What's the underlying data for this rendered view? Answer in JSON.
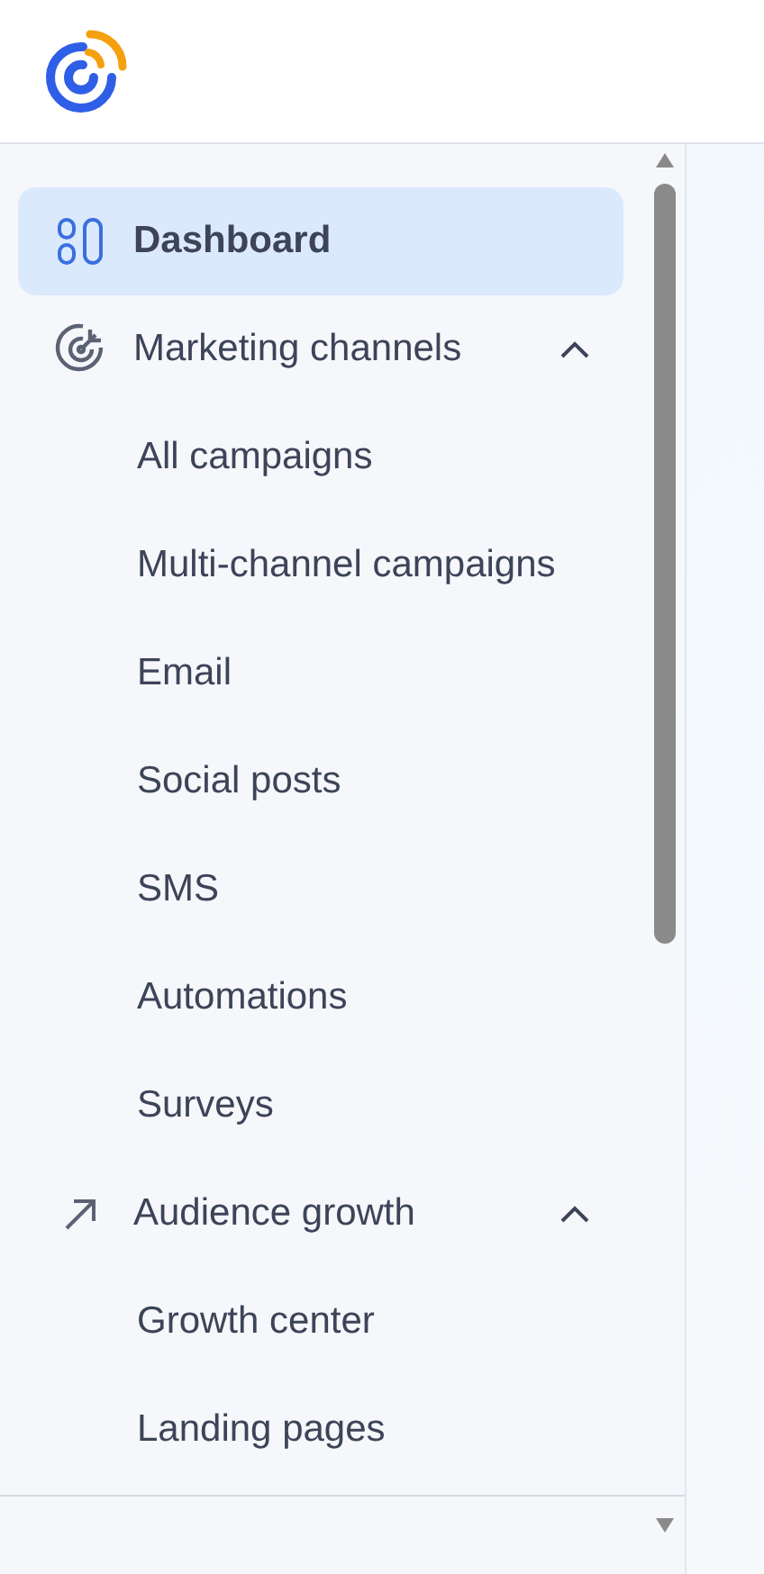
{
  "nav": [
    {
      "label": "Dashboard",
      "selected": true
    },
    {
      "label": "Marketing channels",
      "selected": false,
      "expanded": true,
      "children": [
        {
          "label": "All campaigns",
          "selected": false
        },
        {
          "label": "Multi-channel campaigns",
          "selected": false
        },
        {
          "label": "Email",
          "selected": false
        },
        {
          "label": "Social posts",
          "selected": false
        },
        {
          "label": "SMS",
          "selected": false
        },
        {
          "label": "Automations",
          "selected": false
        },
        {
          "label": "Surveys",
          "selected": false
        }
      ]
    },
    {
      "label": "Audience growth",
      "selected": false,
      "expanded": true,
      "children": [
        {
          "label": "Growth center",
          "selected": false
        },
        {
          "label": "Landing pages",
          "selected": false
        }
      ]
    }
  ]
}
